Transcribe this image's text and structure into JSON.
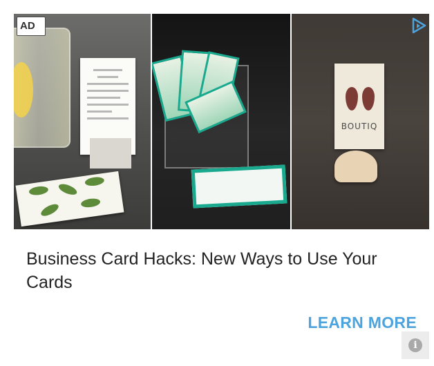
{
  "ad": {
    "badge_label": "AD",
    "adchoices_icon": "adchoices-triangle-icon",
    "headline": "Business Card Hacks: New Ways to Use Your Cards",
    "cta_label": "LEARN MORE",
    "info_icon": "info-icon",
    "info_glyph": "i",
    "images": [
      {
        "icon": "lemonade-menu-card-photo"
      },
      {
        "icon": "acrylic-card-holder-photo"
      },
      {
        "icon": "earring-display-card-photo",
        "brand_text": "BOUTIQ"
      }
    ]
  },
  "colors": {
    "cta": "#4da3dd",
    "headline": "#222222",
    "adchoices": "#4da3dd",
    "teal_accent": "#19a98f"
  }
}
